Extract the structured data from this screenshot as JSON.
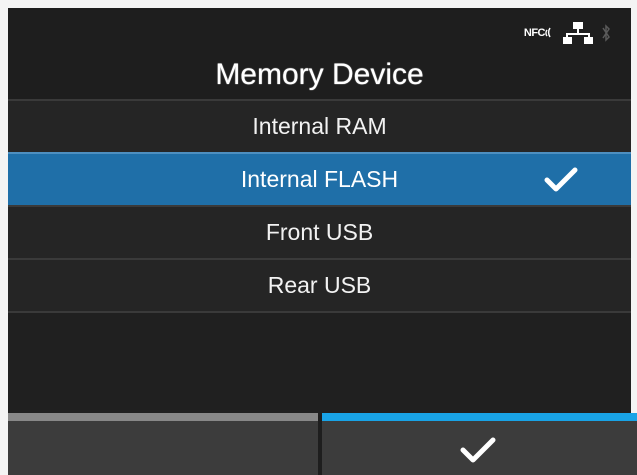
{
  "header": {
    "title": "Memory Device",
    "status": {
      "nfc_label": "NFC",
      "icons": [
        "nfc-icon",
        "network-icon",
        "bluetooth-icon"
      ]
    }
  },
  "list": {
    "items": [
      {
        "label": "Internal RAM",
        "selected": false
      },
      {
        "label": "Internal FLASH",
        "selected": true
      },
      {
        "label": "Front USB",
        "selected": false
      },
      {
        "label": "Rear USB",
        "selected": false
      }
    ]
  },
  "footer": {
    "back_button_icon": "",
    "ok_button_icon": "checkmark-icon"
  },
  "colors": {
    "selection": "#1f6fa8",
    "ok_accent": "#19a3e6",
    "back_accent": "#888888",
    "background": "#1e1e1e"
  }
}
